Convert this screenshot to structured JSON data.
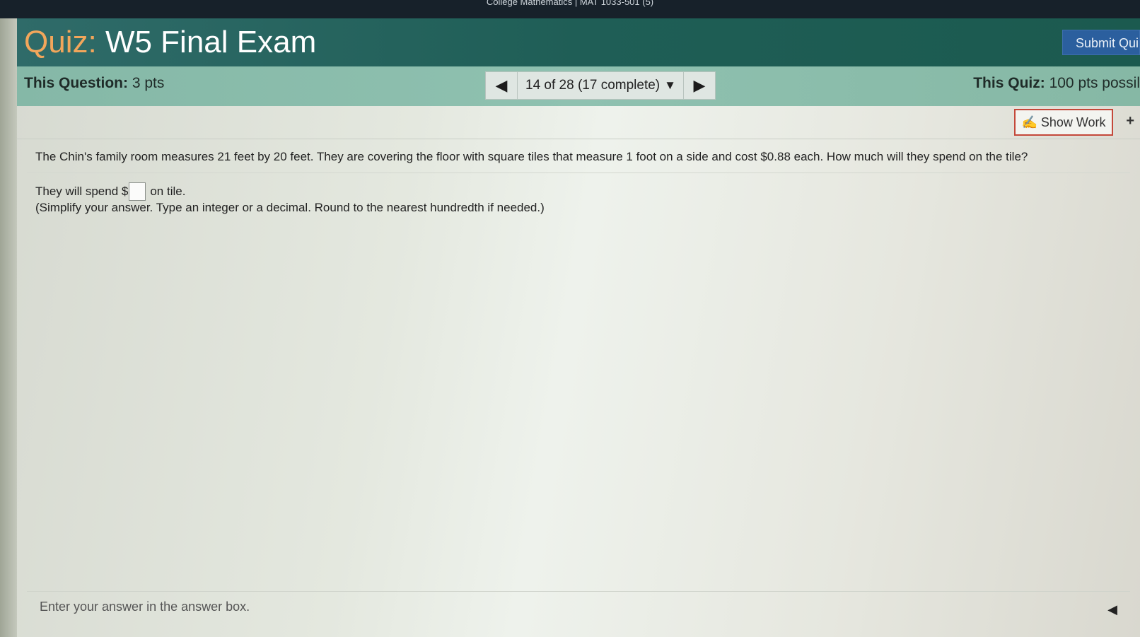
{
  "top_bar": {
    "text": "College Mathematics | MAT 1033-501 (5)"
  },
  "header": {
    "quiz_label": "Quiz:",
    "title": "W5 Final Exam",
    "submit_label": "Submit Qui"
  },
  "info_bar": {
    "question_label": "This Question:",
    "question_points": "3 pts",
    "progress": "14 of 28 (17 complete)",
    "quiz_label": "This Quiz:",
    "quiz_points": "100 pts possil"
  },
  "toolbar": {
    "show_work_label": "Show Work"
  },
  "question": {
    "text": "The Chin's family room measures 21 feet by 20 feet. They are covering the floor with square tiles that measure 1 foot on a side and cost $0.88 each. How much will they spend on the tile?",
    "answer_prefix": "They will spend $",
    "answer_value": "",
    "answer_suffix": "on tile.",
    "hint": "(Simplify your answer. Type an integer or a decimal. Round to the nearest hundredth if needed.)"
  },
  "footer": {
    "instruction": "Enter your answer in the answer box."
  },
  "colors": {
    "title_bar": "#1f5e56",
    "quiz_word": "#f2a65b",
    "info_bar": "#8fc1b0",
    "submit_button": "#2b5f9e",
    "show_work_border": "#c4483a"
  },
  "icons": [
    "prev-arrow-icon",
    "dropdown-caret-icon",
    "next-arrow-icon",
    "pencil-icon",
    "collapse-arrow-icon"
  ]
}
